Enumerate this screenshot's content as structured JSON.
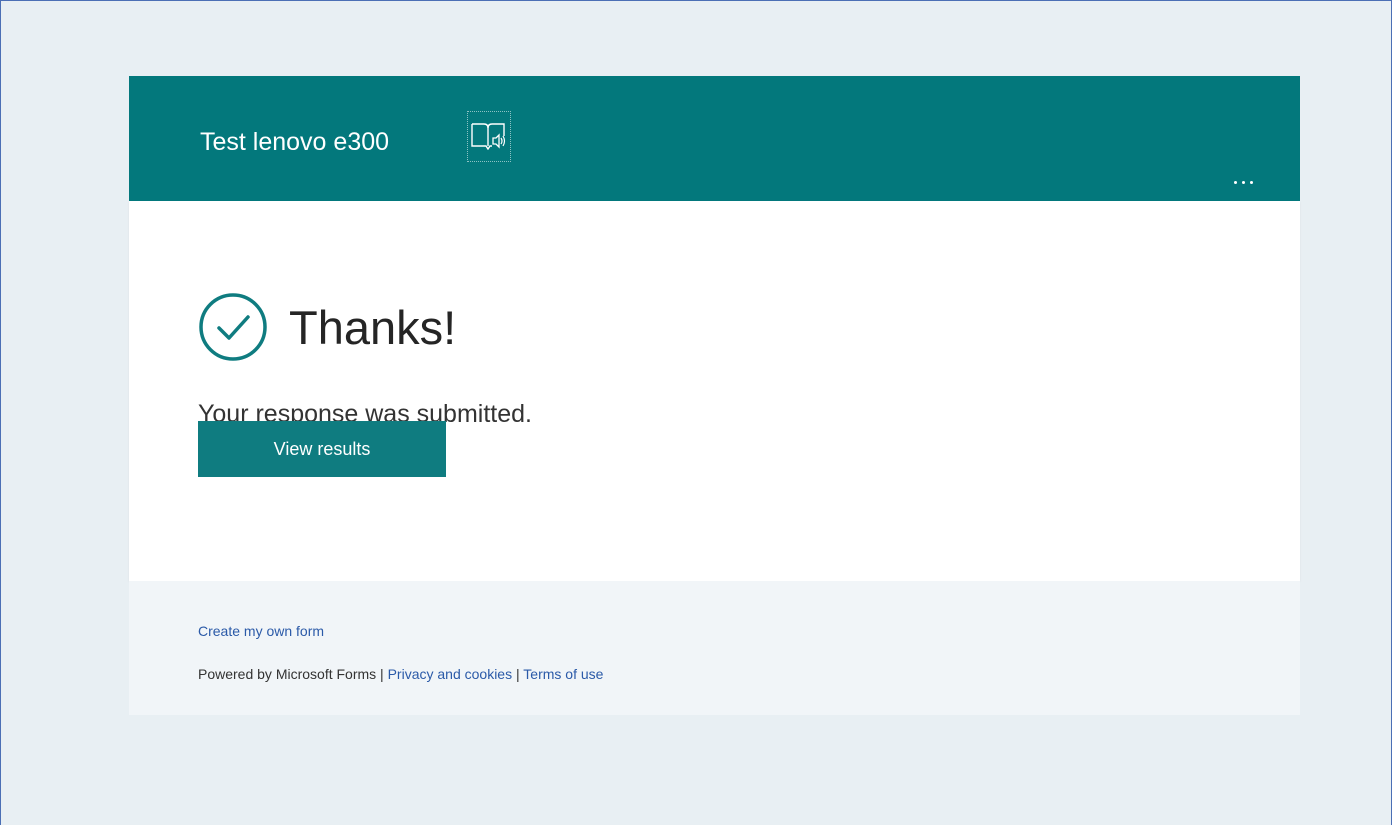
{
  "header": {
    "form_title": "Test lenovo e300",
    "reader_icon": "immersive-reader-icon",
    "more_icon": "more-options-icon",
    "color": "#03787c"
  },
  "confirmation": {
    "icon": "check-circle-icon",
    "title": "Thanks!",
    "message": "Your response was submitted.",
    "view_results_label": "View results"
  },
  "footer": {
    "create_link": "Create my own form",
    "powered_by": "Powered by Microsoft Forms",
    "separator": " | ",
    "privacy_link": "Privacy and cookies",
    "terms_link": "Terms of use"
  },
  "colors": {
    "accent": "#03787c",
    "button": "#0f7c80",
    "link": "#2b5aa8",
    "page_background": "#e8eff3"
  }
}
